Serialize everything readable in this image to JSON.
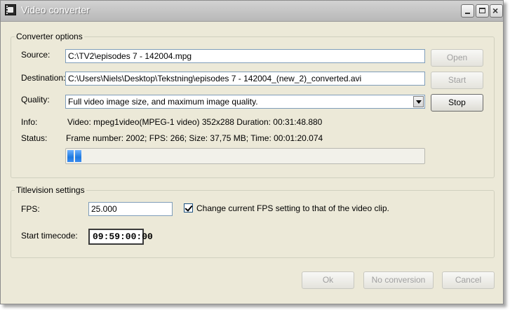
{
  "window": {
    "title": "Video converter",
    "icon": "film-icon"
  },
  "converter_options": {
    "legend": "Converter options",
    "source_label": "Source:",
    "source_value": "C:\\TV2\\episodes 7 - 142004.mpg",
    "destination_label": "Destination:",
    "destination_value": "C:\\Users\\Niels\\Desktop\\Tekstning\\episodes 7 - 142004_(new_2)_converted.avi",
    "quality_label": "Quality:",
    "quality_value": "Full video image size, and maximum image quality.",
    "info_label": "Info:",
    "info_value": "Video: mpeg1video(MPEG-1 video) 352x288 Duration: 00:31:48.880",
    "status_label": "Status:",
    "status_value": "Frame number: 2002; FPS: 266; Size: 37,75 MB; Time: 00:01:20.074",
    "buttons": {
      "open": "Open",
      "start": "Start",
      "stop": "Stop"
    }
  },
  "titlevision_settings": {
    "legend": "Titlevision settings",
    "fps_label": "FPS:",
    "fps_value": "25.000",
    "checkbox_label": "Change current FPS setting to that of the video clip.",
    "checkbox_checked": true,
    "start_timecode_label": "Start timecode:",
    "start_timecode_value": "09:59:00:00"
  },
  "footer_buttons": {
    "ok": "Ok",
    "no_conversion": "No conversion",
    "cancel": "Cancel"
  },
  "colors": {
    "progress": "#1e79e0",
    "titlebar": "#c4c4c4",
    "window_bg": "#ece9d8"
  }
}
